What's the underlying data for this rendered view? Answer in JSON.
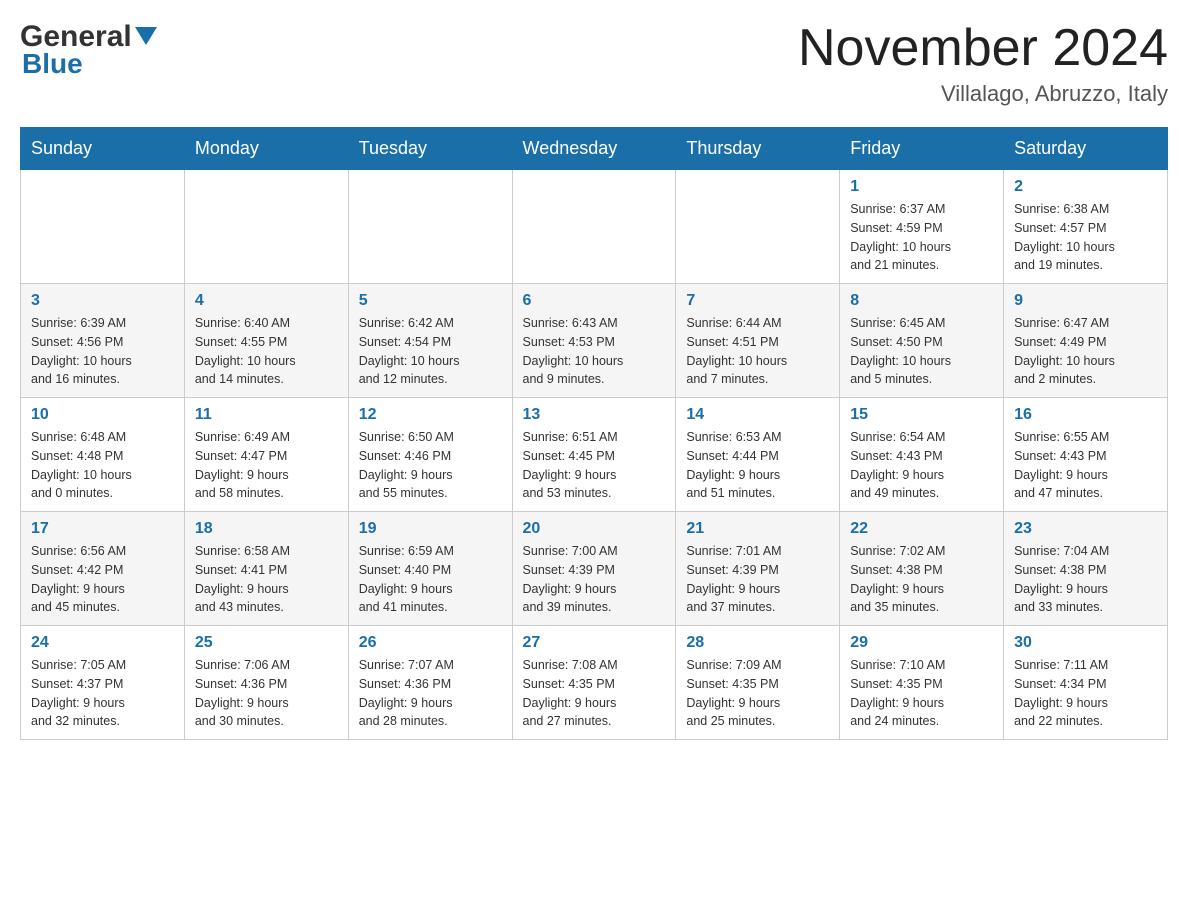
{
  "header": {
    "logo_text_general": "General",
    "logo_text_blue": "Blue",
    "month_title": "November 2024",
    "location": "Villalago, Abruzzo, Italy"
  },
  "weekdays": [
    "Sunday",
    "Monday",
    "Tuesday",
    "Wednesday",
    "Thursday",
    "Friday",
    "Saturday"
  ],
  "weeks": [
    [
      {
        "day": "",
        "info": ""
      },
      {
        "day": "",
        "info": ""
      },
      {
        "day": "",
        "info": ""
      },
      {
        "day": "",
        "info": ""
      },
      {
        "day": "",
        "info": ""
      },
      {
        "day": "1",
        "info": "Sunrise: 6:37 AM\nSunset: 4:59 PM\nDaylight: 10 hours\nand 21 minutes."
      },
      {
        "day": "2",
        "info": "Sunrise: 6:38 AM\nSunset: 4:57 PM\nDaylight: 10 hours\nand 19 minutes."
      }
    ],
    [
      {
        "day": "3",
        "info": "Sunrise: 6:39 AM\nSunset: 4:56 PM\nDaylight: 10 hours\nand 16 minutes."
      },
      {
        "day": "4",
        "info": "Sunrise: 6:40 AM\nSunset: 4:55 PM\nDaylight: 10 hours\nand 14 minutes."
      },
      {
        "day": "5",
        "info": "Sunrise: 6:42 AM\nSunset: 4:54 PM\nDaylight: 10 hours\nand 12 minutes."
      },
      {
        "day": "6",
        "info": "Sunrise: 6:43 AM\nSunset: 4:53 PM\nDaylight: 10 hours\nand 9 minutes."
      },
      {
        "day": "7",
        "info": "Sunrise: 6:44 AM\nSunset: 4:51 PM\nDaylight: 10 hours\nand 7 minutes."
      },
      {
        "day": "8",
        "info": "Sunrise: 6:45 AM\nSunset: 4:50 PM\nDaylight: 10 hours\nand 5 minutes."
      },
      {
        "day": "9",
        "info": "Sunrise: 6:47 AM\nSunset: 4:49 PM\nDaylight: 10 hours\nand 2 minutes."
      }
    ],
    [
      {
        "day": "10",
        "info": "Sunrise: 6:48 AM\nSunset: 4:48 PM\nDaylight: 10 hours\nand 0 minutes."
      },
      {
        "day": "11",
        "info": "Sunrise: 6:49 AM\nSunset: 4:47 PM\nDaylight: 9 hours\nand 58 minutes."
      },
      {
        "day": "12",
        "info": "Sunrise: 6:50 AM\nSunset: 4:46 PM\nDaylight: 9 hours\nand 55 minutes."
      },
      {
        "day": "13",
        "info": "Sunrise: 6:51 AM\nSunset: 4:45 PM\nDaylight: 9 hours\nand 53 minutes."
      },
      {
        "day": "14",
        "info": "Sunrise: 6:53 AM\nSunset: 4:44 PM\nDaylight: 9 hours\nand 51 minutes."
      },
      {
        "day": "15",
        "info": "Sunrise: 6:54 AM\nSunset: 4:43 PM\nDaylight: 9 hours\nand 49 minutes."
      },
      {
        "day": "16",
        "info": "Sunrise: 6:55 AM\nSunset: 4:43 PM\nDaylight: 9 hours\nand 47 minutes."
      }
    ],
    [
      {
        "day": "17",
        "info": "Sunrise: 6:56 AM\nSunset: 4:42 PM\nDaylight: 9 hours\nand 45 minutes."
      },
      {
        "day": "18",
        "info": "Sunrise: 6:58 AM\nSunset: 4:41 PM\nDaylight: 9 hours\nand 43 minutes."
      },
      {
        "day": "19",
        "info": "Sunrise: 6:59 AM\nSunset: 4:40 PM\nDaylight: 9 hours\nand 41 minutes."
      },
      {
        "day": "20",
        "info": "Sunrise: 7:00 AM\nSunset: 4:39 PM\nDaylight: 9 hours\nand 39 minutes."
      },
      {
        "day": "21",
        "info": "Sunrise: 7:01 AM\nSunset: 4:39 PM\nDaylight: 9 hours\nand 37 minutes."
      },
      {
        "day": "22",
        "info": "Sunrise: 7:02 AM\nSunset: 4:38 PM\nDaylight: 9 hours\nand 35 minutes."
      },
      {
        "day": "23",
        "info": "Sunrise: 7:04 AM\nSunset: 4:38 PM\nDaylight: 9 hours\nand 33 minutes."
      }
    ],
    [
      {
        "day": "24",
        "info": "Sunrise: 7:05 AM\nSunset: 4:37 PM\nDaylight: 9 hours\nand 32 minutes."
      },
      {
        "day": "25",
        "info": "Sunrise: 7:06 AM\nSunset: 4:36 PM\nDaylight: 9 hours\nand 30 minutes."
      },
      {
        "day": "26",
        "info": "Sunrise: 7:07 AM\nSunset: 4:36 PM\nDaylight: 9 hours\nand 28 minutes."
      },
      {
        "day": "27",
        "info": "Sunrise: 7:08 AM\nSunset: 4:35 PM\nDaylight: 9 hours\nand 27 minutes."
      },
      {
        "day": "28",
        "info": "Sunrise: 7:09 AM\nSunset: 4:35 PM\nDaylight: 9 hours\nand 25 minutes."
      },
      {
        "day": "29",
        "info": "Sunrise: 7:10 AM\nSunset: 4:35 PM\nDaylight: 9 hours\nand 24 minutes."
      },
      {
        "day": "30",
        "info": "Sunrise: 7:11 AM\nSunset: 4:34 PM\nDaylight: 9 hours\nand 22 minutes."
      }
    ]
  ]
}
